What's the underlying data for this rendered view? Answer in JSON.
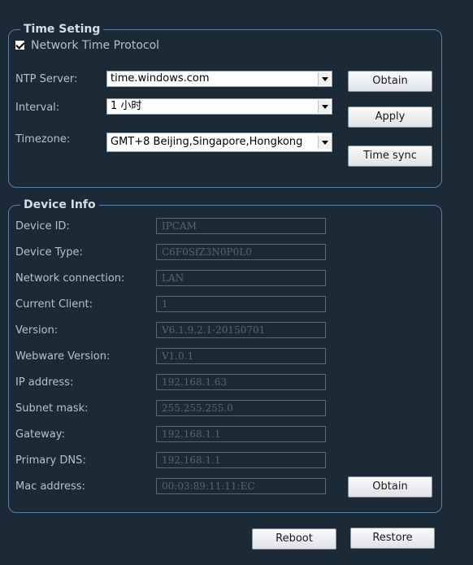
{
  "time_setting": {
    "title": "Time Seting",
    "ntp_checkbox_label": "Network Time Protocol",
    "ntp_checked": true,
    "ntp_server_label": "NTP Server:",
    "ntp_server_value": "time.windows.com",
    "interval_label": "Interval:",
    "interval_value": "1 小时",
    "timezone_label": "Timezone:",
    "timezone_value": "GMT+8  Beijing,Singapore,Hongkong",
    "obtain_button": "Obtain",
    "apply_button": "Apply",
    "time_sync_button": "Time sync"
  },
  "device_info": {
    "title": "Device Info",
    "fields": [
      {
        "label": "Device ID:",
        "value": "IPCAM"
      },
      {
        "label": "Device Type:",
        "value": "C6F0SfZ3N0P0L0"
      },
      {
        "label": "Network connection:",
        "value": "LAN"
      },
      {
        "label": "Current Client:",
        "value": "1"
      },
      {
        "label": "Version:",
        "value": "V6.1.9.2.1-20150701"
      },
      {
        "label": "Webware Version:",
        "value": "V1.0.1"
      },
      {
        "label": "IP address:",
        "value": "192.168.1.63"
      },
      {
        "label": "Subnet mask:",
        "value": "255.255.255.0"
      },
      {
        "label": "Gateway:",
        "value": "192.168.1.1"
      },
      {
        "label": "Primary DNS:",
        "value": "192.168.1.1"
      },
      {
        "label": "Mac address:",
        "value": "00:03:89:11:11:EC"
      }
    ],
    "obtain_button": "Obtain"
  },
  "footer": {
    "reboot_button": "Reboot",
    "restore_button": "Restore"
  },
  "colors": {
    "background": "#1c2937",
    "group_border": "#5b7fa8",
    "readonly_text": "#59636f"
  }
}
